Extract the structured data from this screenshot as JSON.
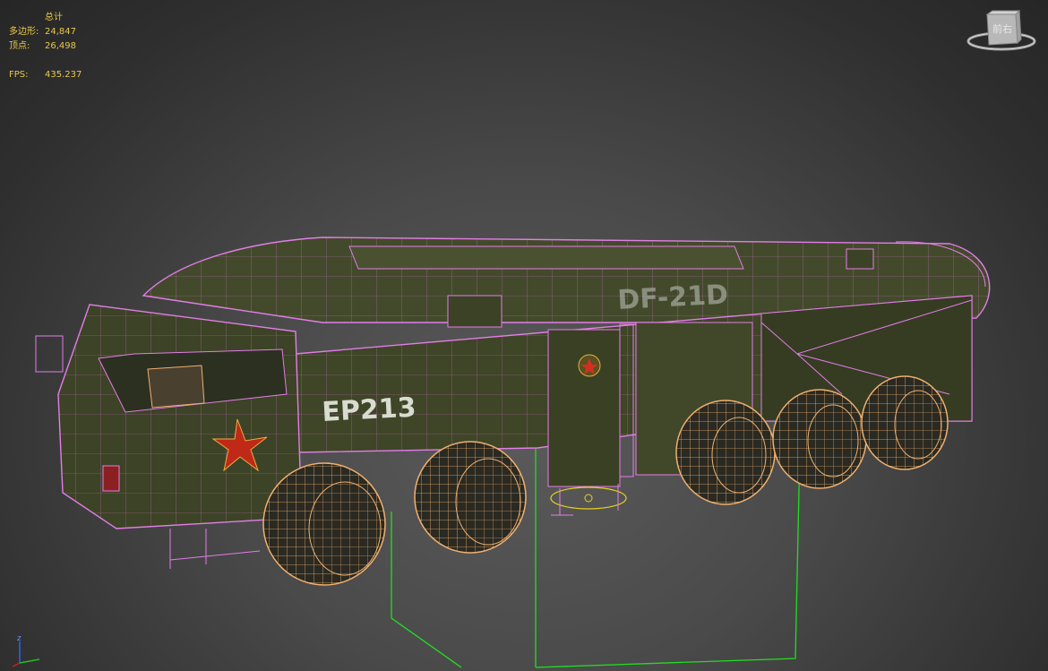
{
  "stats": {
    "header": "总计",
    "polygons_label": "多边形:",
    "polygons_value": "24,847",
    "vertices_label": "顶点:",
    "vertices_value": "26,498",
    "fps_label": "FPS:",
    "fps_value": "435.237"
  },
  "viewcube": {
    "face_label": "前右"
  },
  "model": {
    "cab_marking": "EP213",
    "missile_marking": "DF-21D"
  },
  "axis_labels": {
    "z": "z"
  },
  "colors": {
    "wireframe": "#e27ee8",
    "wheel_wire": "#f0b070",
    "selection_bbox": "#22dd22",
    "body_fill": "#454a2c",
    "stats_text": "#e9c84a"
  }
}
